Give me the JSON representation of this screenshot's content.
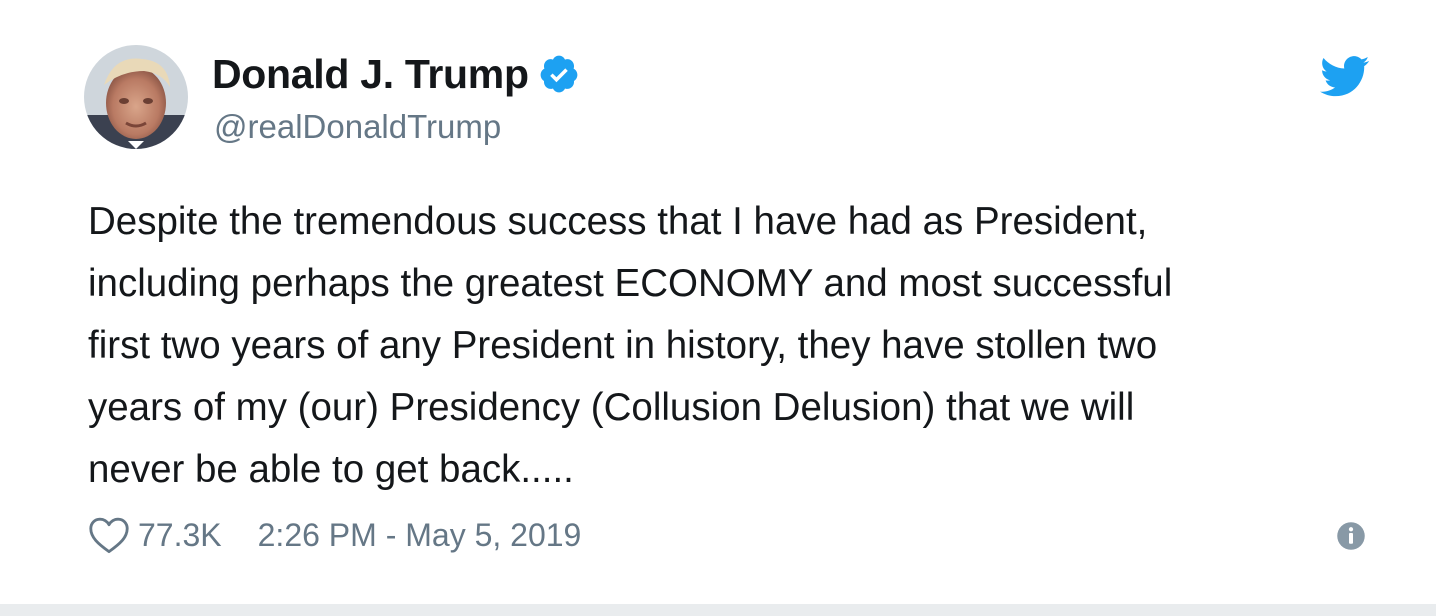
{
  "tweet": {
    "author": {
      "name": "Donald J. Trump",
      "handle": "@realDonaldTrump",
      "verified": true
    },
    "text_lines": [
      "Despite the tremendous success that I have had as President,",
      "including perhaps the greatest ECONOMY and most successful",
      "first two years of any President in history, they have stollen two",
      "years of my (our) Presidency (Collusion Delusion) that we will",
      "never be able to get back....."
    ],
    "likes": "77.3K",
    "timestamp": "2:26 PM - May 5, 2019"
  },
  "icons": {
    "verified": "verified-badge-icon",
    "brand": "twitter-bird-icon",
    "like": "heart-icon",
    "info": "info-icon"
  },
  "colors": {
    "accent": "#1da1f2",
    "text": "#14171a",
    "secondary_text": "#657786",
    "background": "#ffffff"
  }
}
